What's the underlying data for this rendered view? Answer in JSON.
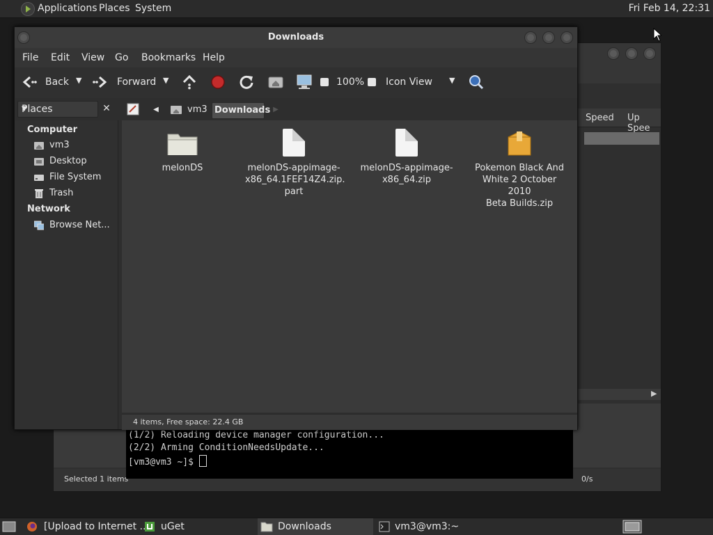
{
  "top_panel": {
    "menus": [
      "Applications",
      "Places",
      "System"
    ],
    "clock": "Fri Feb 14, 22:31"
  },
  "uget": {
    "columns": [
      "Speed",
      "Up Spee"
    ],
    "status": "Selected 1 items",
    "speed_tail": "0/s"
  },
  "terminal": {
    "lines": [
      "(1/2) Reloading device manager configuration...",
      "(2/2) Arming ConditionNeedsUpdate...",
      "[vm3@vm3 ~]$ "
    ]
  },
  "file_manager": {
    "title": "Downloads",
    "menu": [
      "File",
      "Edit",
      "View",
      "Go",
      "Bookmarks",
      "Help"
    ],
    "toolbar": {
      "back": "Back",
      "forward": "Forward",
      "zoom": "100%",
      "view_mode": "Icon View"
    },
    "sidebar": {
      "selector": "Places",
      "sections": [
        {
          "title": "Computer",
          "items": [
            "vm3",
            "Desktop",
            "File System",
            "Trash"
          ]
        },
        {
          "title": "Network",
          "items": [
            "Browse Net..."
          ]
        }
      ]
    },
    "breadcrumb": [
      "vm3",
      "Downloads"
    ],
    "files": [
      {
        "name": "melonDS",
        "kind": "folder"
      },
      {
        "name": "melonDS-appimage-\nx86_64.1FEF14Z4.zip.\npart",
        "kind": "file"
      },
      {
        "name": "melonDS-appimage-\nx86_64.zip",
        "kind": "file"
      },
      {
        "name": "Pokemon Black And\nWhite 2 October 2010\nBeta Builds.zip",
        "kind": "archive"
      }
    ],
    "status": "4 items, Free space: 22.4 GB"
  },
  "taskbar": {
    "items": [
      "[Upload to Internet ...",
      "uGet",
      "Downloads",
      "vm3@vm3:~"
    ]
  },
  "colors": {
    "panel": "#2b2b2b",
    "window": "#2e2e2e",
    "content": "#3a3a3a",
    "accent_green": "#8fb34a"
  }
}
